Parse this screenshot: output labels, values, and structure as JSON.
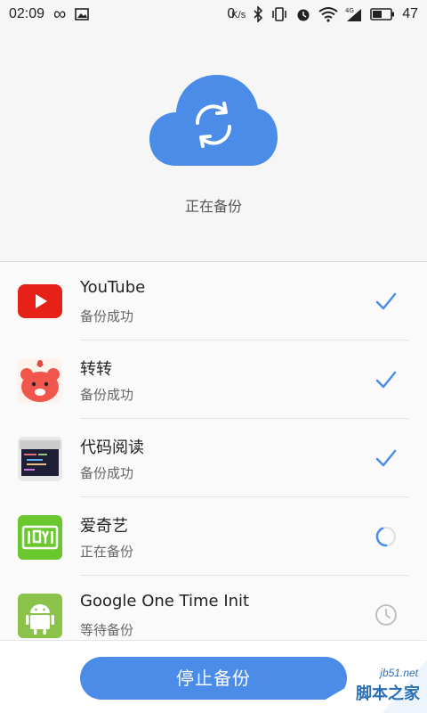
{
  "status_bar": {
    "time": "02:09",
    "net_speed": "0",
    "net_unit": "K/s",
    "battery": "47"
  },
  "hero": {
    "status_text": "正在备份"
  },
  "apps": [
    {
      "name": "YouTube",
      "status": "备份成功",
      "state": "done",
      "icon": "youtube-icon"
    },
    {
      "name": "转转",
      "status": "备份成功",
      "state": "done",
      "icon": "zhuanzhuan-icon"
    },
    {
      "name": "代码阅读",
      "status": "备份成功",
      "state": "done",
      "icon": "codeviewer-icon"
    },
    {
      "name": "爱奇艺",
      "status": "正在备份",
      "state": "in-progress",
      "icon": "iqiyi-icon"
    },
    {
      "name": "Google One Time Init",
      "status": "等待备份",
      "state": "waiting",
      "icon": "android-icon"
    }
  ],
  "bottom": {
    "stop_label": "停止备份"
  },
  "watermark": {
    "url": "jb51.net",
    "name": "脚本之家"
  },
  "colors": {
    "accent": "#4a8ce8",
    "check": "#4a8ce8",
    "youtube": "#e62117",
    "iqiyi": "#6ac72d",
    "android": "#8bc34a"
  }
}
